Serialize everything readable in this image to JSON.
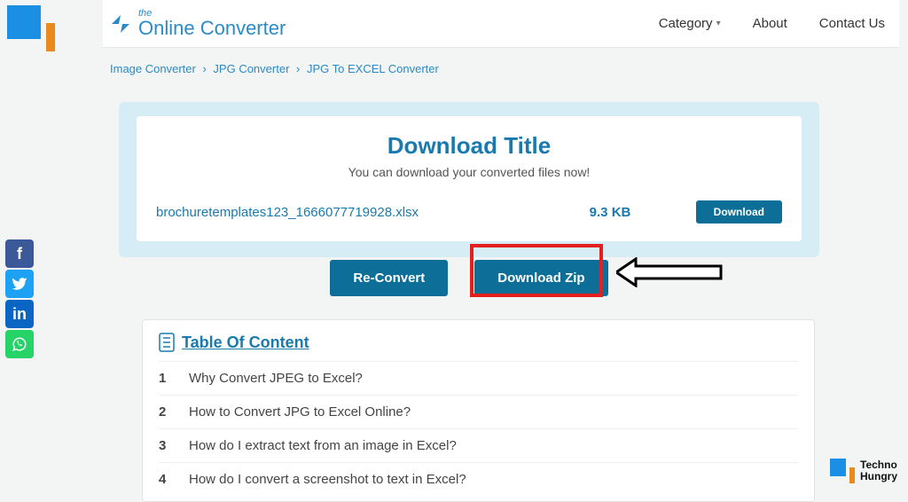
{
  "brand": {
    "the": "the",
    "title": "Online Converter"
  },
  "nav": {
    "category": "Category",
    "about": "About",
    "contact": "Contact Us"
  },
  "breadcrumb": {
    "a": "Image Converter",
    "b": "JPG Converter",
    "c": "JPG To EXCEL Converter"
  },
  "download": {
    "title": "Download Title",
    "subtitle": "You can download your converted files now!",
    "file_name": "brochuretemplates123_1666077719928.xlsx",
    "file_size": "9.3 KB",
    "button": "Download"
  },
  "actions": {
    "reconvert": "Re-Convert",
    "zip": "Download Zip"
  },
  "toc": {
    "title": "Table Of Content",
    "items": [
      {
        "n": "1",
        "q": "Why Convert JPEG to Excel?"
      },
      {
        "n": "2",
        "q": "How to Convert JPG to Excel Online?"
      },
      {
        "n": "3",
        "q": "How do I extract text from an image in Excel?"
      },
      {
        "n": "4",
        "q": "How do I convert a screenshot to text in Excel?"
      }
    ]
  },
  "footer_logo": {
    "line1": "Techno",
    "line2": "Hungry"
  }
}
